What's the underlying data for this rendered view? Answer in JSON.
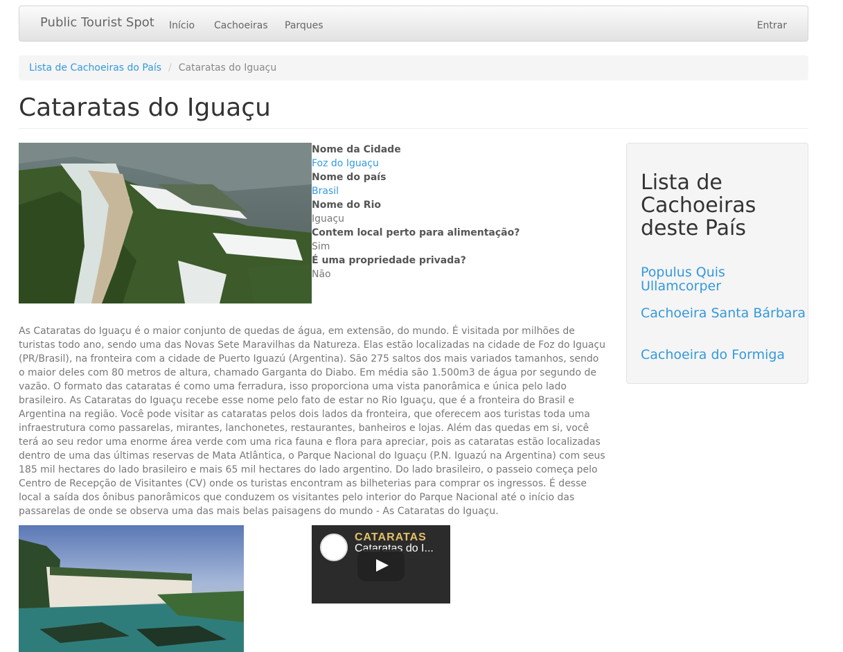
{
  "navbar": {
    "brand": "Public Tourist Spot",
    "links": [
      "Início",
      "Cachoeiras",
      "Parques"
    ],
    "right_link": "Entrar"
  },
  "breadcrumb": {
    "parent": "Lista de Cachoeiras do País",
    "current": "Cataratas do Iguaçu"
  },
  "page_title": "Cataratas do Iguaçu",
  "details": [
    {
      "label": "Nome da Cidade",
      "value": "Foz do Iguaçu"
    },
    {
      "label": "Nome do país",
      "value": "Brasil"
    },
    {
      "label": "Nome do Rio",
      "value": "Iguaçu"
    },
    {
      "label": "Contem local perto para alimentação?",
      "value": "Sim"
    },
    {
      "label": "É uma propriedade privada?",
      "value": "Não"
    }
  ],
  "description": "As Cataratas do Iguaçu é o maior conjunto de quedas de água, em extensão, do mundo. É visitada por milhões de turistas todo ano, sendo uma das Novas Sete Maravilhas da Natureza. Elas estão localizadas na cidade de Foz do Iguaçu (PR/Brasil), na fronteira com a cidade de Puerto Iguazú (Argentina). São 275 saltos dos mais variados tamanhos, sendo o maior deles com 80 metros de altura, chamado Garganta do Diabo. Em média são 1.500m3 de água por segundo de vazão. O formato das cataratas é como uma ferradura, isso proporciona uma vista panorâmica e única pelo lado brasileiro. As Cataratas do Iguaçu recebe esse nome pelo fato de estar no Rio Iguaçu, que é a fronteira do Brasil e Argentina na região. Você pode visitar as cataratas pelos dois lados da fronteira, que oferecem aos turistas toda uma infraestrutura como passarelas, mirantes, lanchonetes, restaurantes, banheiros e lojas. Além das quedas em si, você terá ao seu redor uma enorme área verde com uma rica fauna e flora para apreciar, pois as cataratas estão localizadas dentro de uma das últimas reservas de Mata Atlântica, o Parque Nacional do Iguaçu (P.N. Iguazú na Argentina) com seus 185 mil hectares do lado brasileiro e mais 65 mil hectares do lado argentino. Do lado brasileiro, o passeio começa pelo Centro de Recepção de Visitantes (CV) onde os turistas encontram as bilheterias para comprar os ingressos. É desse local a saída dos ônibus panorâmicos que conduzem os visitantes pelo interior do Parque Nacional até o início das passarelas de onde se observa uma das mais belas paisagens do mundo - As Cataratas do Iguaçu.",
  "video": {
    "banner": "CATARATAS",
    "title": "Cataratas do I..."
  },
  "sidebar": {
    "title": "Lista de Cachoeiras deste País",
    "links": [
      "Populus Quis Ullamcorper",
      "Cachoeira Santa Bárbara",
      "Cachoeira do Formiga"
    ]
  },
  "colors": {
    "link": "#3399dd",
    "title": "#333333",
    "body_text": "#777777"
  }
}
